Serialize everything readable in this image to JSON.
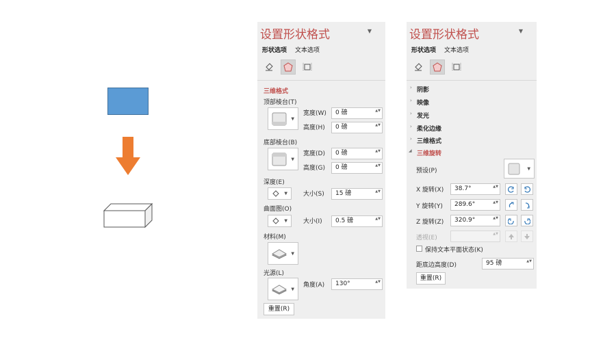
{
  "panel_left": {
    "title": "设置形状格式",
    "tabs": [
      "形状选项",
      "文本选项"
    ],
    "section": "三维格式",
    "top_bevel": "顶部棱台(T)",
    "bottom_bevel": "底部棱台(B)",
    "width_label": "宽度(W)",
    "height_label": "高度(H)",
    "width_b_label": "宽度(D)",
    "height_b_label": "高度(G)",
    "top_width": "0 磅",
    "top_height": "0 磅",
    "bottom_width": "0 磅",
    "bottom_height": "0 磅",
    "depth_label": "深度(E)",
    "depth_size_label": "大小(S)",
    "depth_size": "15 磅",
    "contour_label": "曲面图(O)",
    "contour_size_label": "大小(I)",
    "contour_size": "0.5 磅",
    "material_label": "材料(M)",
    "lighting_label": "光源(L)",
    "angle_label": "角度(A)",
    "angle": "130°",
    "reset": "重置(R)"
  },
  "panel_right": {
    "title": "设置形状格式",
    "tabs": [
      "形状选项",
      "文本选项"
    ],
    "groups": [
      "阴影",
      "映像",
      "发光",
      "柔化边缘",
      "三维格式"
    ],
    "expanded": "三维旋转",
    "preset_label": "预设(P)",
    "x_label": "X 旋转(X)",
    "x_value": "38.7°",
    "y_label": "Y 旋转(Y)",
    "y_value": "289.6°",
    "z_label": "Z 旋转(Z)",
    "z_value": "320.9°",
    "perspective_label": "透视(E)",
    "keep_text_flat": "保持文本平面状态(K)",
    "distance_label": "距底边高度(D)",
    "distance_value": "95 磅",
    "reset": "重置(R)"
  },
  "colors": {
    "accent": "#c0504d",
    "rect_fill": "#5b9bd5",
    "arrow": "#ed7d31",
    "panel_bg": "#efefef"
  }
}
